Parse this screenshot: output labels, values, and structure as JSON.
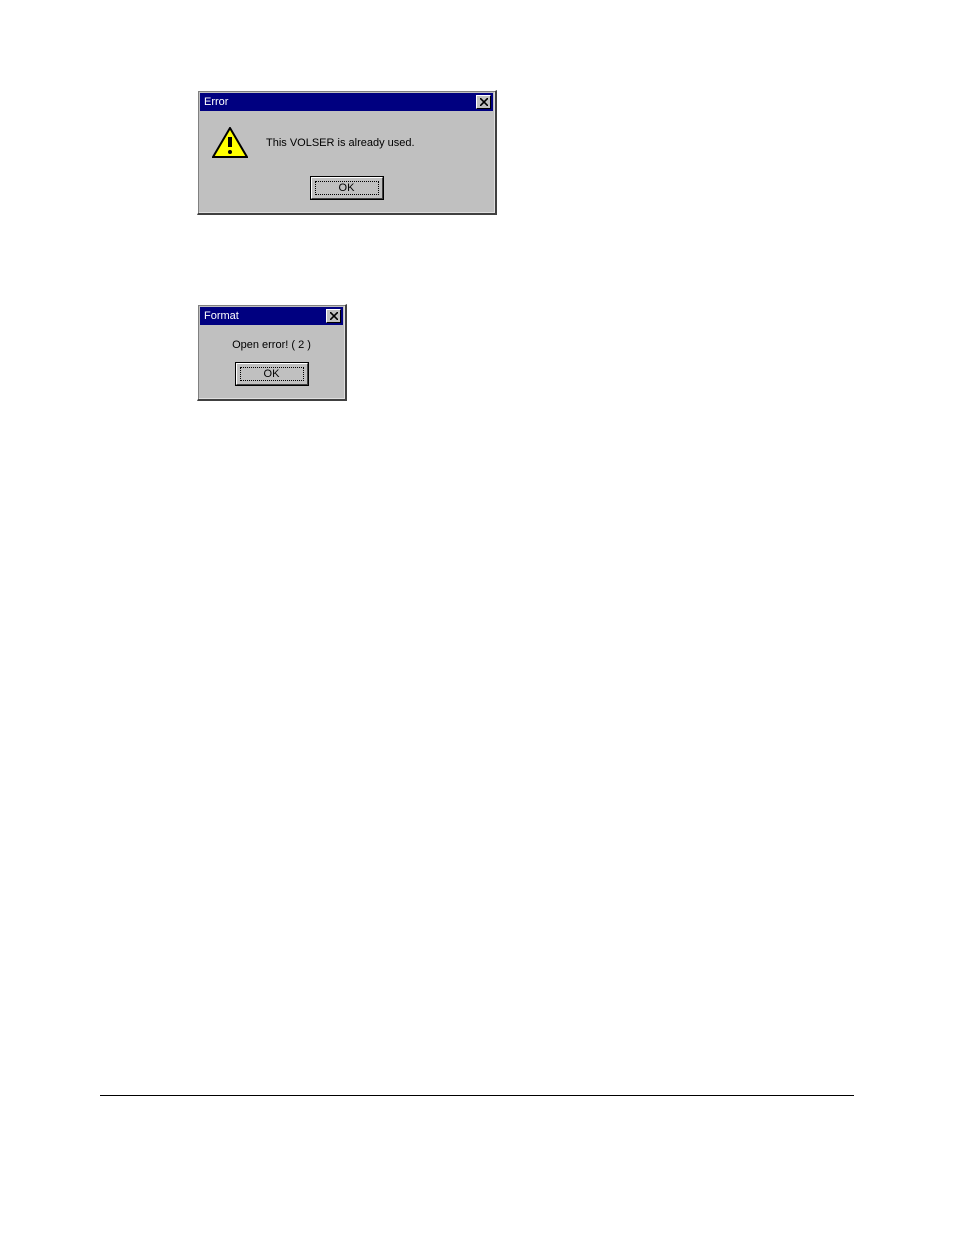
{
  "dialogs": {
    "error": {
      "title": "Error",
      "message": "This VOLSER is already used.",
      "ok_label": "OK"
    },
    "format": {
      "title": "Format",
      "message": "Open error! ( 2 )",
      "ok_label": "OK"
    }
  }
}
